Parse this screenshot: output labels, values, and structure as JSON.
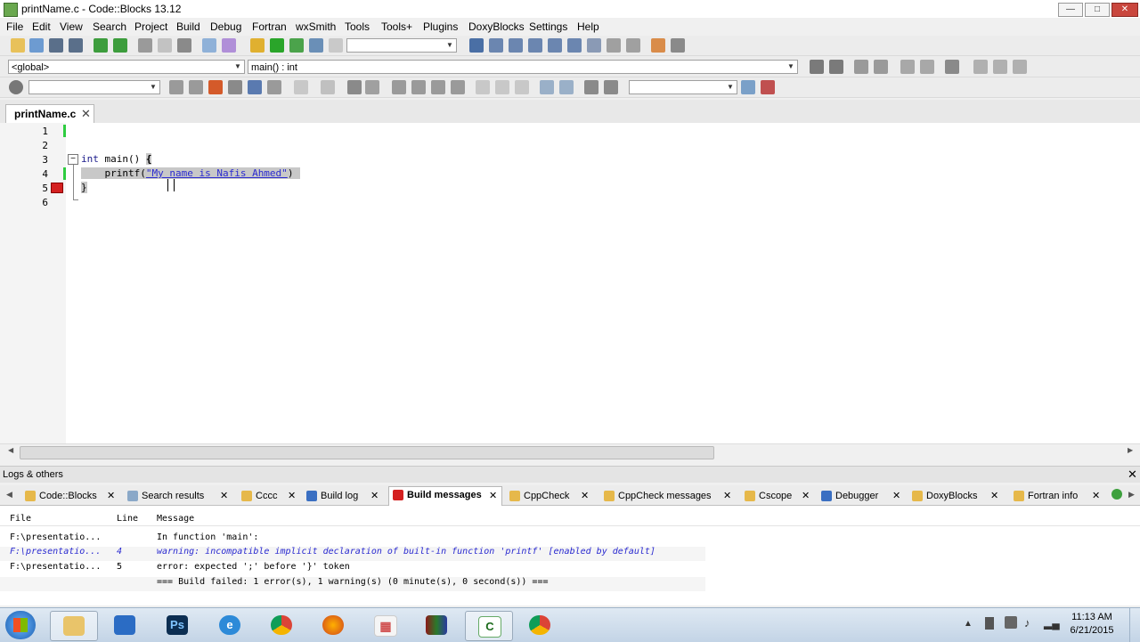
{
  "window": {
    "title": "printName.c - Code::Blocks 13.12"
  },
  "menu": [
    "File",
    "Edit",
    "View",
    "Search",
    "Project",
    "Build",
    "Debug",
    "Fortran",
    "wxSmith",
    "Tools",
    "Tools+",
    "Plugins",
    "DoxyBlocks",
    "Settings",
    "Help"
  ],
  "toolbar": {
    "scope_combo": "<global>",
    "function_combo": "main() : int"
  },
  "editor": {
    "tab_label": "printName.c",
    "line_numbers": [
      "1",
      "2",
      "3",
      "4",
      "5",
      "6"
    ],
    "lines": {
      "l3_kw": "int",
      "l3_rest": " main() ",
      "l3_brace": "{",
      "l4_fn": "    printf(",
      "l4_str": "\"My name is Nafis Ahmed\"",
      "l4_end": ")",
      "l5": "}"
    }
  },
  "logs": {
    "panel_title": "Logs & others",
    "tabs": [
      "Code::Blocks",
      "Search results",
      "Cccc",
      "Build log",
      "Build messages",
      "CppCheck",
      "CppCheck messages",
      "Cscope",
      "Debugger",
      "DoxyBlocks",
      "Fortran info"
    ],
    "active_tab": "Build messages",
    "columns": {
      "file": "File",
      "line": "Line",
      "message": "Message"
    },
    "rows": [
      {
        "file": "F:\\presentatio...",
        "line": "",
        "message": "In function 'main':"
      },
      {
        "file": "F:\\presentatio...",
        "line": "4",
        "message": "warning: incompatible implicit declaration of built-in function 'printf' [enabled by default]"
      },
      {
        "file": "F:\\presentatio...",
        "line": "5",
        "message": "error: expected ';' before '}' token"
      },
      {
        "file": "",
        "line": "",
        "message": "=== Build failed: 1 error(s), 1 warning(s) (0 minute(s), 0 second(s)) ==="
      }
    ]
  },
  "taskbar": {
    "time": "11:13 AM",
    "date": "6/21/2015",
    "apps": [
      "explorer",
      "outlook",
      "photoshop",
      "internet-explorer",
      "chrome",
      "firefox",
      "app-grid",
      "winrar",
      "codeblocks",
      "chrome"
    ]
  },
  "colors": {
    "accent": "#2a2ad0",
    "error_marker": "#d42020",
    "selection": "#c8c8c8",
    "green_change": "#2ecc40"
  }
}
